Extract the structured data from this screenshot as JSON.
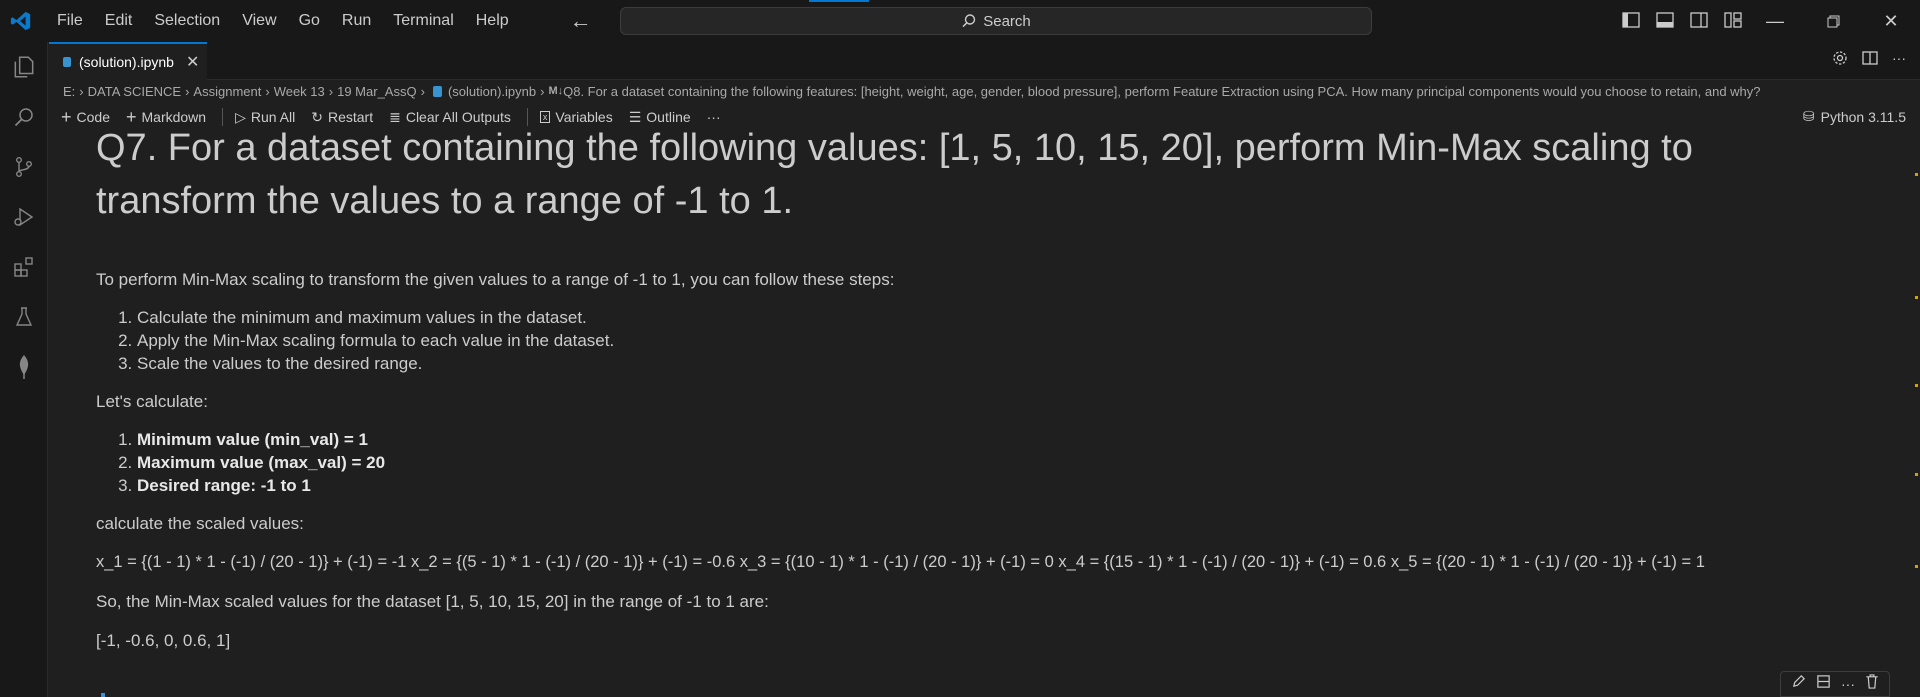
{
  "menu": [
    "File",
    "Edit",
    "Selection",
    "View",
    "Go",
    "Run",
    "Terminal",
    "Help"
  ],
  "search": {
    "label": "Search"
  },
  "tab": {
    "title": "(solution).ipynb"
  },
  "breadcrumb": {
    "items": [
      "E:",
      "DATA SCIENCE",
      "Assignment",
      "Week 13",
      "19 Mar_AssQ",
      "(solution).ipynb"
    ],
    "md_badge": "M↓",
    "cell": "Q8. For a dataset containing the following features: [height, weight, age, gender, blood pressure], perform Feature Extraction using PCA. How many principal components would you choose to retain, and why?"
  },
  "toolbar": {
    "code": "Code",
    "markdown": "Markdown",
    "run_all": "Run All",
    "restart": "Restart",
    "clear": "Clear All Outputs",
    "variables": "Variables",
    "outline": "Outline",
    "more": "···",
    "kernel": "Python 3.11.5"
  },
  "cell": {
    "heading_line1": "Q7. For a dataset containing the following values: [1, 5, 10, 15, 20], perform Min-Max scaling to",
    "heading_line2": "transform the values to a range of -1 to 1.",
    "intro": "To perform Min-Max scaling to transform the given values to a range of -1 to 1, you can follow these steps:",
    "steps": [
      "Calculate the minimum and maximum values in the dataset.",
      "Apply the Min-Max scaling formula to each value in the dataset.",
      "Scale the values to the desired range."
    ],
    "lets": "Let's calculate:",
    "values": [
      "Minimum value (min_val) = 1",
      "Maximum value (max_val) = 20",
      "Desired range: -1 to 1"
    ],
    "calc_label": "calculate the scaled values:",
    "formula": "x_1 = {(1 - 1) * 1 - (-1) / (20 - 1)} + (-1) = -1 x_2 = {(5 - 1) * 1 - (-1) / (20 - 1)} + (-1) = -0.6 x_3 = {(10 - 1) * 1 - (-1) / (20 - 1)} + (-1) = 0 x_4 = {(15 - 1) * 1 - (-1) / (20 - 1)} + (-1) = 0.6 x_5 = {(20 - 1) * 1 - (-1) / (20 - 1)} + (-1) = 1",
    "conclusion": "So, the Min-Max scaled values for the dataset [1, 5, 10, 15, 20] in the range of -1 to 1 are:",
    "result": "[-1, -0.6, 0, 0.6, 1]"
  },
  "colors": {
    "accent": "#0078d4",
    "background": "#1f1f1f",
    "chrome": "#181818",
    "marker": "#d7a100"
  }
}
